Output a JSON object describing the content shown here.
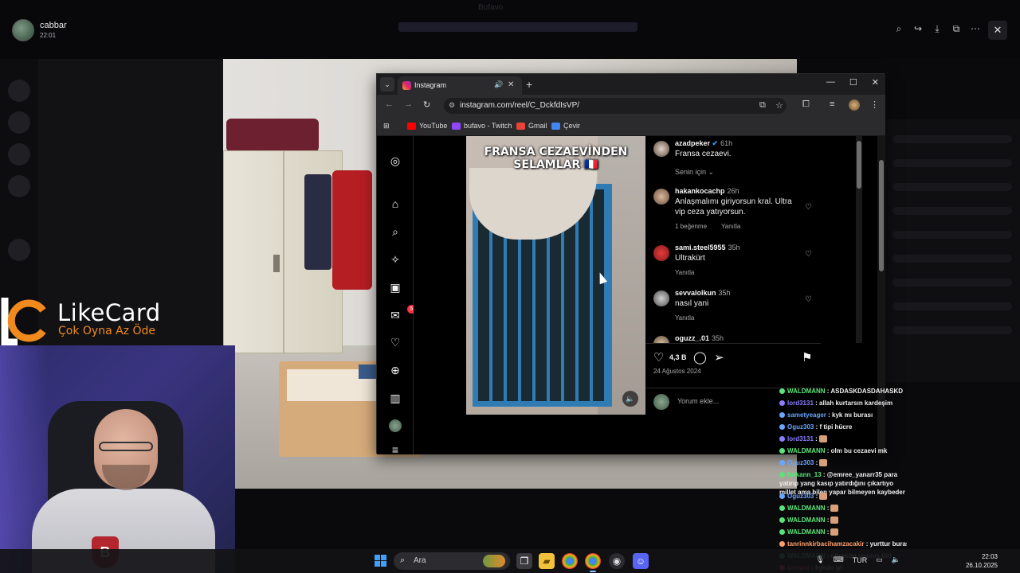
{
  "discord": {
    "top_title": "Bufavo",
    "user": {
      "name": "cabbar",
      "time": "22:01"
    },
    "toolbar_icons": [
      "zoom-icon",
      "forward-icon",
      "download-icon",
      "popout-icon",
      "more-icon"
    ],
    "close_label": "✕"
  },
  "browser": {
    "tab_title": "Instagram",
    "url": "instagram.com/reel/C_DckfdIsVP/",
    "bookmarks": [
      {
        "label": "YouTube",
        "color": "#ff0000"
      },
      {
        "label": "bufavo - Twitch",
        "color": "#9146ff"
      },
      {
        "label": "Gmail",
        "color": "#ea4335"
      },
      {
        "label": "Çevir",
        "color": "#4285f4"
      }
    ]
  },
  "instagram": {
    "reel_caption_line1": "FRANSA CEZAEVİNDEN",
    "reel_caption_line2": "SELAMLAR 🇫🇷",
    "notification_count": "5",
    "post": {
      "user": "azadpeker",
      "time": "61h",
      "caption": "Fransa cezaevi.",
      "filter_label": "Senin için"
    },
    "comments": [
      {
        "user": "hakankocachp",
        "time": "26h",
        "text": "Anlaşmalımı giriyorsun kral. Ultra vip ceza yatıyorsun.",
        "likes": "1 beğenme",
        "reply": "Yanıtla"
      },
      {
        "user": "sami.steel5955",
        "time": "35h",
        "text": "Ultrakürt",
        "reply": "Yanıtla"
      },
      {
        "user": "sevvalolkun",
        "time": "35h",
        "text": "nasıl yani",
        "reply": "Yanıtla"
      },
      {
        "user": "oguzz_.01",
        "time": "35h",
        "text": ""
      }
    ],
    "likes": "4,3 B",
    "date": "24 Ağustos 2024",
    "comment_placeholder": "Yorum ekle..."
  },
  "overlay": {
    "brand": "LikeCard",
    "tagline": "Çok Oyna  Az Öde",
    "brand_accent": "#f08a1c"
  },
  "webcam": {
    "crest_letter": "B"
  },
  "chat": [
    {
      "user": "WALDMANN",
      "text": " : ASDASKDASDAHASKD",
      "color": "#5be37a"
    },
    {
      "user": "lord3131",
      "text": " : allah kurtarsın kardeşim",
      "color": "#8a7dff"
    },
    {
      "user": "sametyeager",
      "text": " : kyk mı burası",
      "color": "#6aa6ff"
    },
    {
      "user": "Oguz303",
      "text": " : f tipi hücre",
      "color": "#6aa6ff"
    },
    {
      "user": "lord3131",
      "text": " :",
      "color": "#8a7dff"
    },
    {
      "user": "WALDMANN",
      "text": " : olm bu cezaevi mk",
      "color": "#5be37a"
    },
    {
      "user": "Oguz303",
      "text": " :",
      "color": "#6aa6ff"
    },
    {
      "user": "furkann_13",
      "text": " : @emree_yanarr35 para yatırıp yang kasıp yatırdığını çıkartıyo millet ama bilen yapar bilmeyen kaybeder",
      "color": "#5be37a"
    },
    {
      "user": "Oguz303",
      "text": " :",
      "color": "#6aa6ff"
    },
    {
      "user": "WALDMANN",
      "text": " :",
      "color": "#5be37a"
    },
    {
      "user": "WALDMANN",
      "text": " :",
      "color": "#5be37a"
    },
    {
      "user": "WALDMANN",
      "text": " :",
      "color": "#5be37a"
    },
    {
      "user": "tanrinnkirbacihamzacakir",
      "text": " : yurttur burası",
      "color": "#ff9f6a"
    },
    {
      "user": "WALDMANN",
      "text": " : ultrakürt yazmış biri",
      "color": "#5be37a"
    },
    {
      "user": "lordpro",
      "text": " : kykdn iyi",
      "color": "#ff4b4b"
    }
  ],
  "taskbar": {
    "search_label": "Ara",
    "language": "TUR",
    "time": "22:03",
    "date": "26.10.2025"
  }
}
